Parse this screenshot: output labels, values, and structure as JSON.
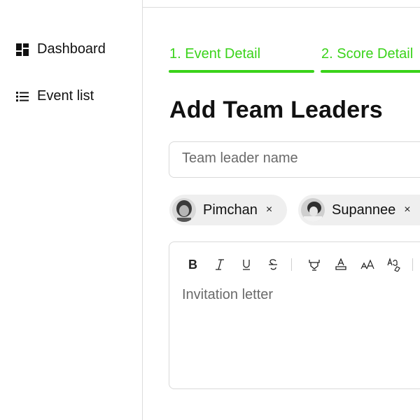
{
  "sidebar": {
    "items": [
      {
        "label": "Dashboard",
        "icon": "dashboard-icon"
      },
      {
        "label": "Event list",
        "icon": "list-icon"
      }
    ]
  },
  "steps": [
    {
      "label": "1. Event Detail",
      "state": "active"
    },
    {
      "label": "2. Score Detail",
      "state": "active"
    }
  ],
  "form": {
    "title": "Add Team Leaders",
    "leader_input": {
      "placeholder": "Team leader name",
      "value": ""
    },
    "chips": [
      {
        "name": "Pimchan",
        "avatar": "avatar-photo"
      },
      {
        "name": "Supannee",
        "avatar": "avatar-photo"
      }
    ],
    "remove_glyph": "×",
    "editor": {
      "placeholder": "Invitation letter",
      "toolbar": [
        "bold",
        "italic",
        "underline",
        "strikethrough",
        "highlight",
        "text-color",
        "font-size",
        "clear-format"
      ]
    }
  },
  "colors": {
    "accent": "#3ad31a",
    "border": "#d9d9d9",
    "chip_bg": "#efefef"
  }
}
